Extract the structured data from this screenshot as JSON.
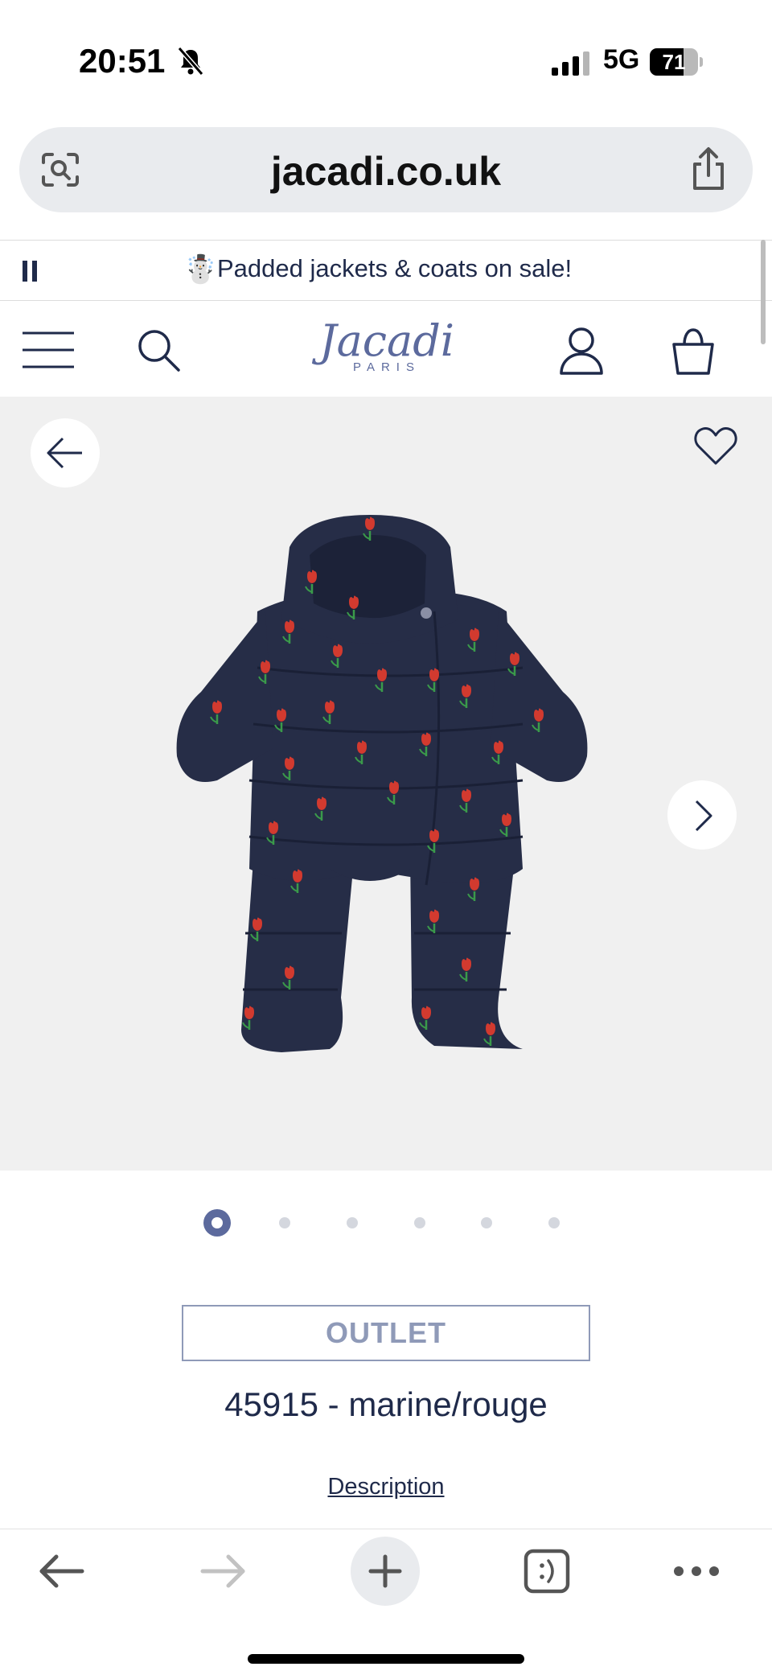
{
  "status_bar": {
    "time": "20:51",
    "network": "5G",
    "battery": "71"
  },
  "browser": {
    "url": "jacadi.co.uk"
  },
  "promo": {
    "emoji": "☃️",
    "text": "Padded jackets & coats on sale!"
  },
  "header": {
    "logo": "Jacadi",
    "logo_sub": "PARIS"
  },
  "gallery": {
    "slide_count": 6,
    "active_index": 0
  },
  "product": {
    "badge": "OUTLET",
    "title": "45915 - marine/rouge",
    "description_link": "Description"
  },
  "colors": {
    "brand": "#5c6a9d",
    "navy": "#1f2a4a",
    "garment": "#262d47",
    "flower": "#d23a2f",
    "leaf": "#3a9a4a"
  }
}
